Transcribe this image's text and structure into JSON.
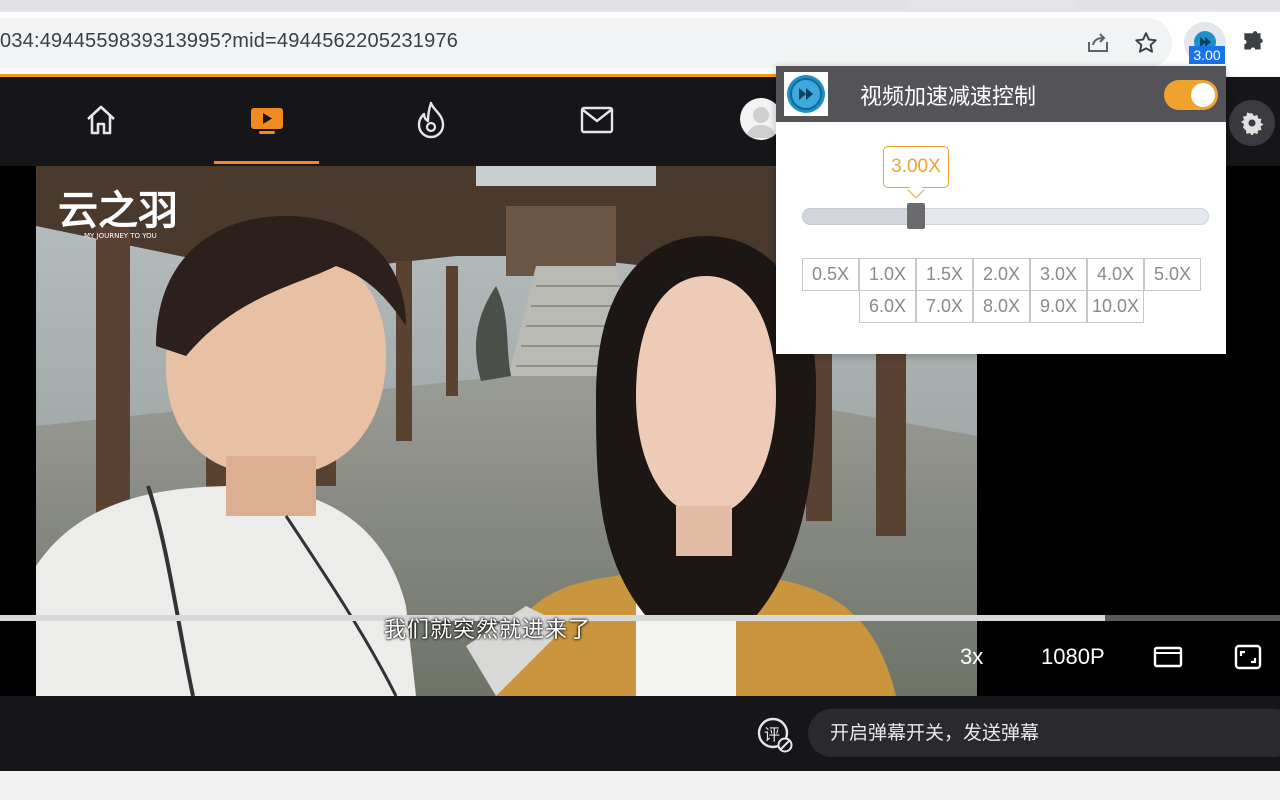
{
  "browser": {
    "url": "034:4944559839313995?mid=4944562205231976",
    "extension_badge": "3.00"
  },
  "site_nav": {
    "items": [
      "home",
      "video",
      "hot",
      "messages"
    ],
    "active": "video"
  },
  "player": {
    "subtitle": "我们就突然就进来了",
    "speed_label": "3x",
    "quality_label": "1080P",
    "progress_fraction": 0.863,
    "watermark": "云之羽",
    "watermark_sub": "MY JOURNEY TO YOU"
  },
  "danmaku": {
    "placeholder": "开启弹幕开关，发送弹幕"
  },
  "extension_popup": {
    "title": "视频加速减速控制",
    "enabled": true,
    "current_speed_label": "3.00X",
    "slider_fraction": 0.28,
    "speed_options_row1": [
      "0.5X",
      "1.0X",
      "1.5X",
      "2.0X",
      "3.0X",
      "4.0X",
      "5.0X"
    ],
    "speed_options_row2": [
      "6.0X",
      "7.0X",
      "8.0X",
      "9.0X",
      "10.0X"
    ],
    "accent_color": "#f0a22e"
  }
}
